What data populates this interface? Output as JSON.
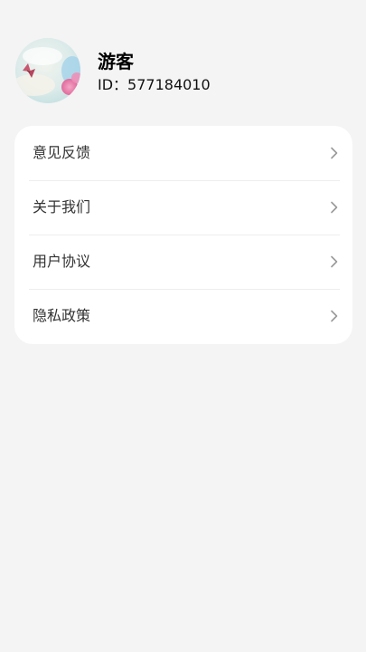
{
  "profile": {
    "username": "游客",
    "id_text": "ID：577184010"
  },
  "menu": {
    "items": [
      {
        "label": "意见反馈",
        "icon": "chevron-right-icon"
      },
      {
        "label": "关于我们",
        "icon": "chevron-right-icon"
      },
      {
        "label": "用户协议",
        "icon": "chevron-right-icon"
      },
      {
        "label": "隐私政策",
        "icon": "chevron-right-icon"
      }
    ]
  },
  "colors": {
    "page_background": "#f4f4f4",
    "card_background": "#ffffff",
    "text_primary": "#000000",
    "text_secondary": "#333333",
    "chevron": "#9a9a9a",
    "divider": "#eeeeee"
  }
}
